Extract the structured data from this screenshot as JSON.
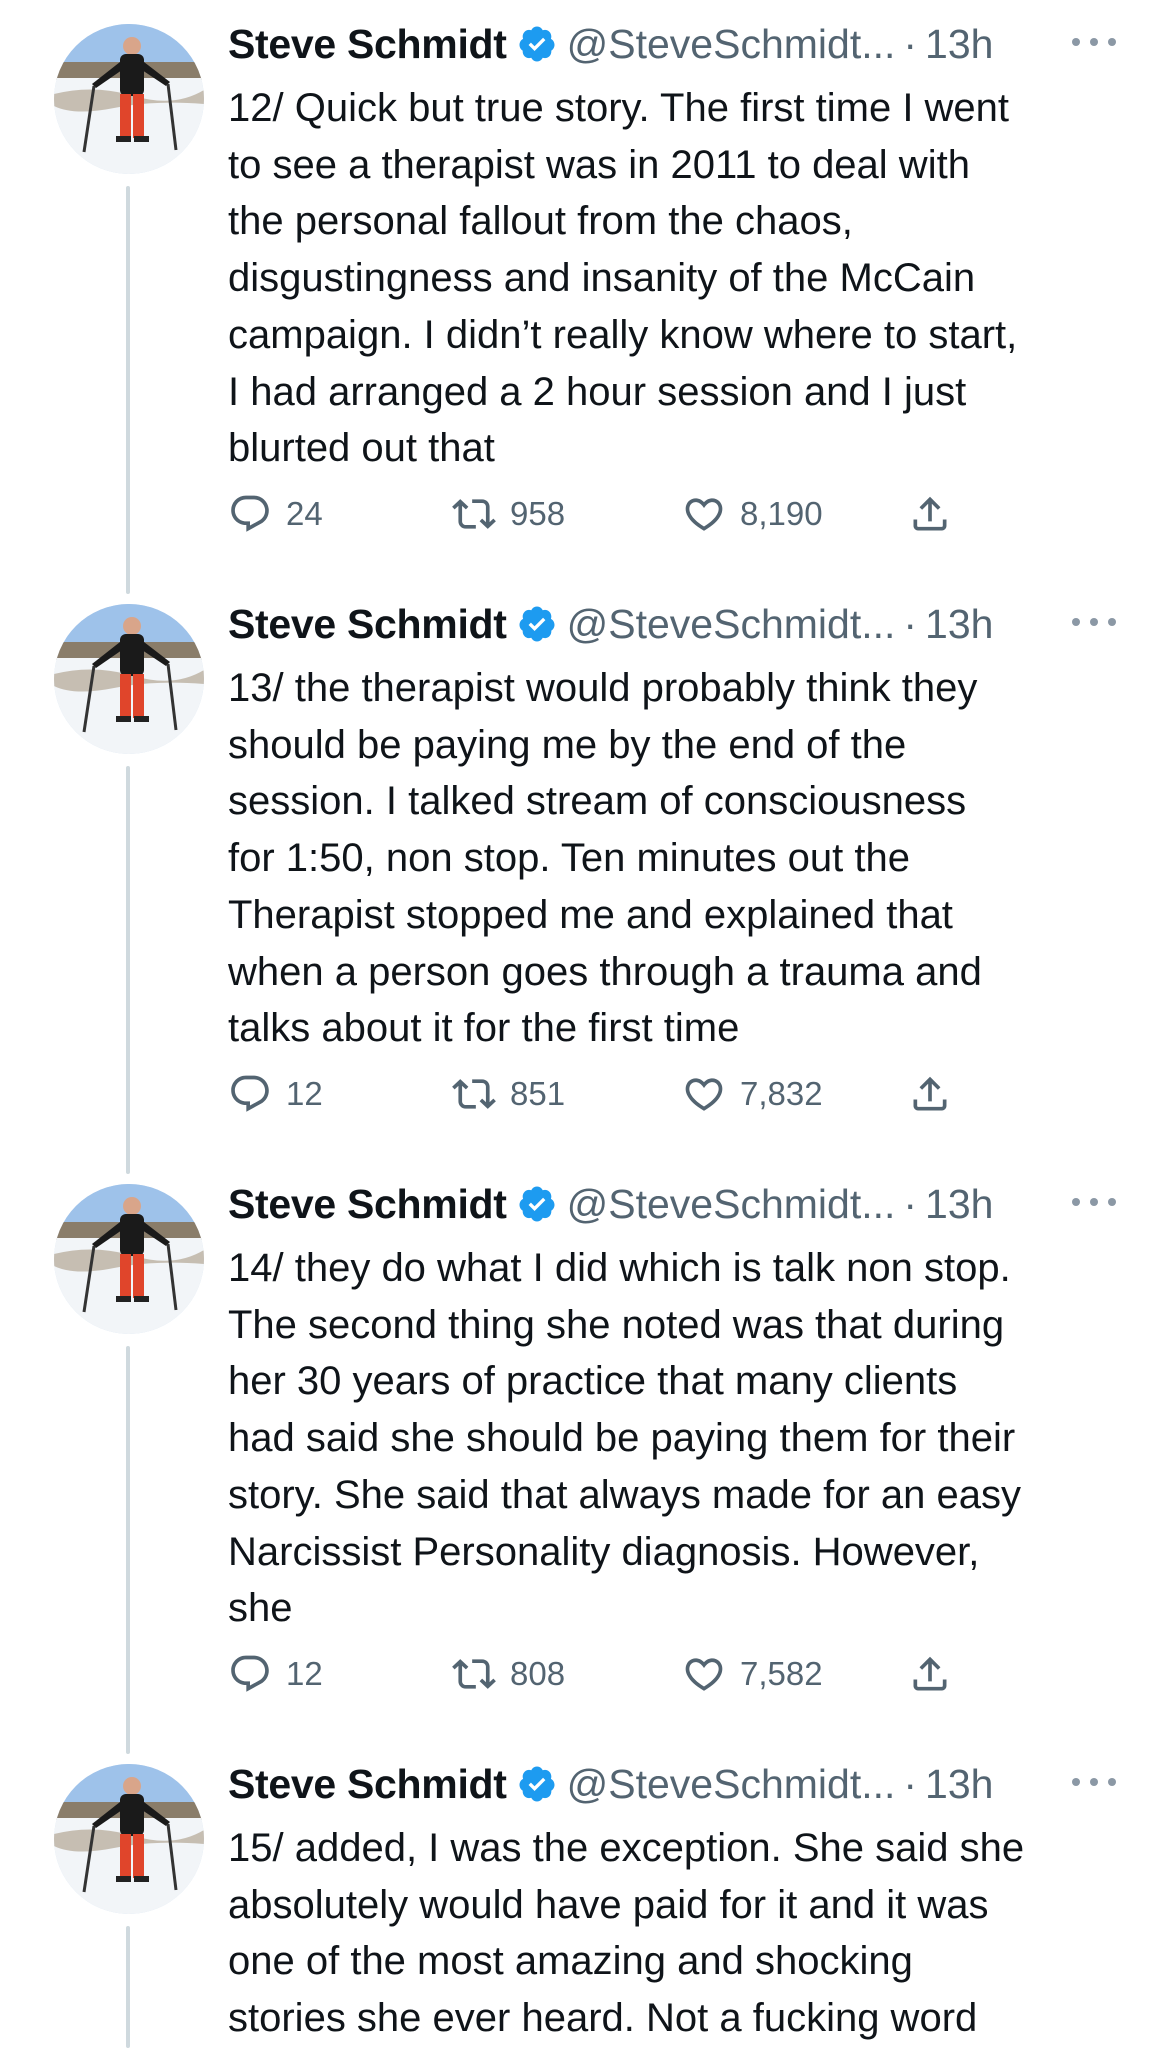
{
  "tweets": [
    {
      "author_name": "Steve Schmidt",
      "handle": "@SteveSchmidt...",
      "dot": "·",
      "time": "13h",
      "lines": [
        "12/ Quick but true story. The first time I went",
        "to see a therapist was in 2011 to deal with",
        "the personal fallout from the chaos,",
        "disgustingness and insanity of the McCain",
        "campaign. I didn’t really know where to start,",
        "I had arranged a 2 hour session and I just",
        "blurted out that"
      ],
      "replies": "24",
      "retweets": "958",
      "likes": "8,190"
    },
    {
      "author_name": "Steve Schmidt",
      "handle": "@SteveSchmidt...",
      "dot": "·",
      "time": "13h",
      "lines": [
        "13/ the therapist would probably think they",
        "should be paying me by the end of the",
        "session. I talked  stream of consciousness",
        "for 1:50, non stop. Ten minutes out the",
        "Therapist stopped me and explained that",
        "when a person goes through a trauma and",
        "talks about it for the first time"
      ],
      "replies": "12",
      "retweets": "851",
      "likes": "7,832"
    },
    {
      "author_name": "Steve Schmidt",
      "handle": "@SteveSchmidt...",
      "dot": "·",
      "time": "13h",
      "lines": [
        "14/ they do what I did which is  talk non stop.",
        "The second thing she noted was that during",
        "her 30 years of practice that many clients",
        "had said she should be paying them for their",
        "story. She said that always made for an easy",
        "Narcissist Personality diagnosis. However,",
        "she"
      ],
      "replies": "12",
      "retweets": "808",
      "likes": "7,582"
    },
    {
      "author_name": "Steve Schmidt",
      "handle": "@SteveSchmidt...",
      "dot": "·",
      "time": "13h",
      "lines": [
        "15/ added, I was the exception. She said she",
        "absolutely would have paid for it and it was",
        "one of the most amazing and shocking",
        "stories she ever heard. Not a fucking word"
      ]
    }
  ],
  "icons": {
    "verified": "verified-badge-icon",
    "more": "more-options-icon",
    "reply": "reply-icon",
    "retweet": "retweet-icon",
    "like": "like-heart-icon",
    "share": "share-icon"
  },
  "colors": {
    "verified_blue": "#1d9bf0",
    "secondary_text": "#536471",
    "thread_line": "#cfd9de"
  }
}
